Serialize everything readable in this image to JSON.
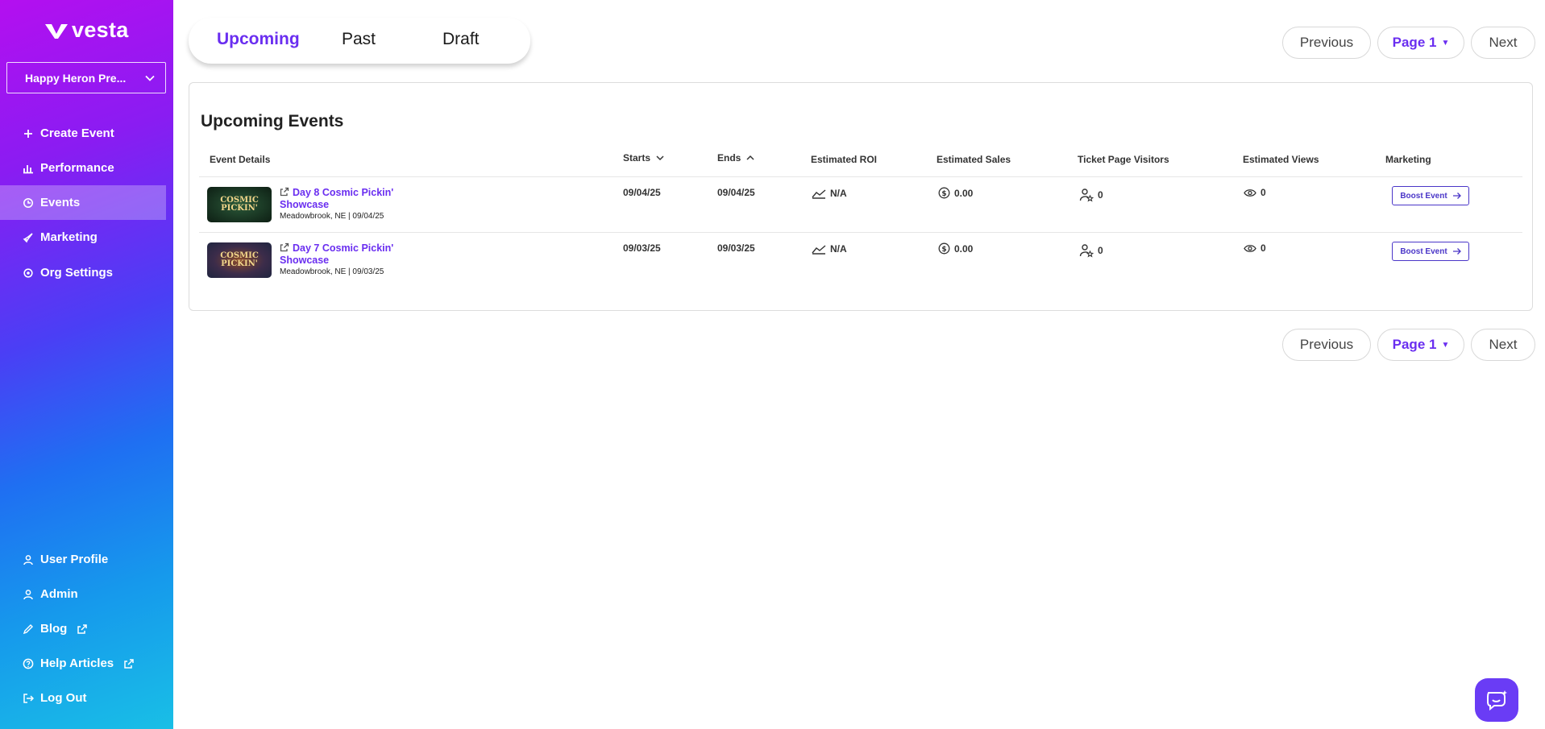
{
  "brand": {
    "name": "vesta"
  },
  "org_selector": {
    "value": "Happy Heron Pre..."
  },
  "nav": {
    "create_event": "Create Event",
    "performance": "Performance",
    "events": "Events",
    "marketing": "Marketing",
    "org_settings": "Org Settings",
    "user_profile": "User Profile",
    "admin": "Admin",
    "blog": "Blog",
    "help_articles": "Help Articles",
    "log_out": "Log Out"
  },
  "tabs": {
    "upcoming": "Upcoming",
    "past": "Past",
    "draft": "Draft",
    "active": "Upcoming"
  },
  "pagination": {
    "previous": "Previous",
    "page": "Page 1",
    "next": "Next"
  },
  "panel": {
    "title": "Upcoming Events",
    "columns": {
      "event_details": "Event Details",
      "starts": "Starts",
      "ends": "Ends",
      "estimated_roi": "Estimated ROI",
      "estimated_sales": "Estimated Sales",
      "ticket_page_visitors": "Ticket Page Visitors",
      "estimated_views": "Estimated Views",
      "marketing": "Marketing"
    },
    "rows": [
      {
        "title": "Day 8 Cosmic Pickin' Showcase",
        "meta": "Meadowbrook, NE | 09/04/25",
        "thumb_text_1": "COSMIC",
        "thumb_text_2": "PICKIN'",
        "starts": "09/04/25",
        "ends": "09/04/25",
        "roi": "N/A",
        "sales": "0.00",
        "visitors": "0",
        "views": "0",
        "action": "Boost Event"
      },
      {
        "title": "Day 7 Cosmic Pickin' Showcase",
        "meta": "Meadowbrook, NE | 09/03/25",
        "thumb_text_1": "COSMIC",
        "thumb_text_2": "PICKIN'",
        "starts": "09/03/25",
        "ends": "09/03/25",
        "roi": "N/A",
        "sales": "0.00",
        "visitors": "0",
        "views": "0",
        "action": "Boost Event"
      }
    ]
  },
  "colors": {
    "accent": "#6a2ef0",
    "boost_border": "#4a36c8",
    "chat": "#6a3cf5"
  },
  "icons": {
    "logo": "vesta-logo-icon",
    "chevron": "chevron-down-icon",
    "support": "chat-support-icon"
  }
}
